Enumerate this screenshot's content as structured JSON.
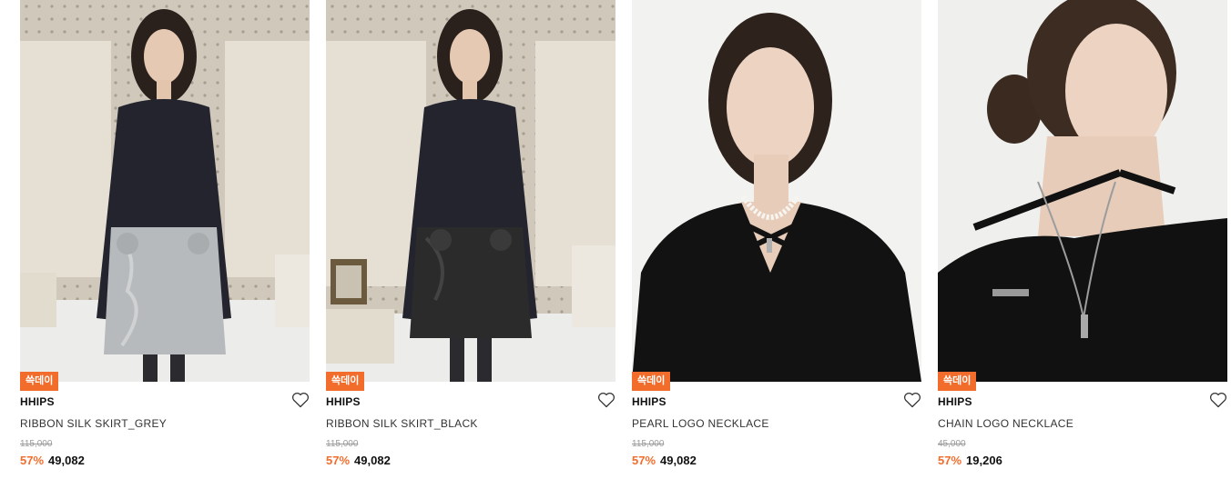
{
  "products": [
    {
      "badge": "쓱데이",
      "brand": "HHIPS",
      "name": "RIBBON SILK SKIRT_GREY",
      "original_price": "115,000",
      "discount": "57%",
      "price": "49,082",
      "image": {
        "kind": "model-grey-skirt",
        "top_color": "#23242e",
        "bottom_color": "#b7babc"
      }
    },
    {
      "badge": "쓱데이",
      "brand": "HHIPS",
      "name": "RIBBON SILK SKIRT_BLACK",
      "original_price": "115,000",
      "discount": "57%",
      "price": "49,082",
      "image": {
        "kind": "model-black-skirt",
        "top_color": "#23242e",
        "bottom_color": "#2b2b2b"
      }
    },
    {
      "badge": "쓱데이",
      "brand": "HHIPS",
      "name": "PEARL LOGO NECKLACE",
      "original_price": "115,000",
      "discount": "57%",
      "price": "49,082",
      "image": {
        "kind": "pearl-necklace-closeup",
        "top_color": "#121212"
      }
    },
    {
      "badge": "쓱데이",
      "brand": "HHIPS",
      "name": "CHAIN LOGO NECKLACE",
      "original_price": "45,000",
      "discount": "57%",
      "price": "19,206",
      "image": {
        "kind": "chain-necklace-closeup",
        "top_color": "#111111"
      }
    }
  ],
  "colors": {
    "accent": "#f26d2c",
    "text": "#111111",
    "muted": "#9a9a9a"
  },
  "icons": {
    "wishlist": "heart-outline-icon"
  }
}
